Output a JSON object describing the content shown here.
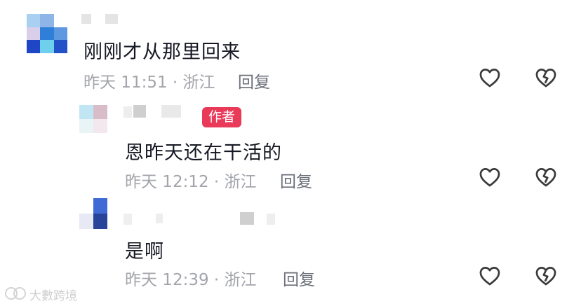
{
  "comments": [
    {
      "text": "刚刚才从那里回来",
      "meta": "昨天 11:51 · 浙江",
      "reply_label": "回复"
    },
    {
      "author_badge": "作者",
      "text": "恩昨天还在干活的",
      "meta": "昨天 12:12 · 浙江",
      "reply_label": "回复"
    },
    {
      "text": "是啊",
      "meta": "昨天 12:39 · 浙江",
      "reply_label": "回复"
    }
  ],
  "icons": {
    "like": "heart-icon",
    "dislike": "broken-heart-icon"
  },
  "colors": {
    "badge": "#ea3a5a",
    "meta_text": "#a3a5ab",
    "reply_text": "#6b6e78",
    "icon_stroke": "#3a3a3a"
  },
  "watermark": {
    "text": "大數跨境"
  }
}
